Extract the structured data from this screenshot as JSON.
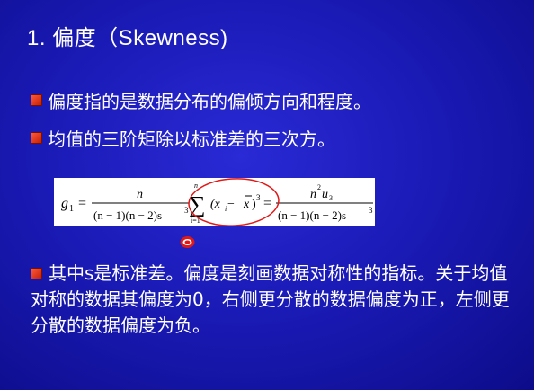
{
  "title": "1. 偏度（Skewness)",
  "bullets": [
    "偏度指的是数据分布的偏倾方向和程度。",
    "均值的三阶矩除以标准差的三次方。"
  ],
  "formula": {
    "lhs": "g",
    "lhs_sub": "1",
    "eq": "=",
    "num1": "n",
    "den1": "(n − 1)(n − 2)s",
    "den1_sup": "3",
    "sum_top": "n",
    "sum_bottom": "i=1",
    "sum_symbol": "∑",
    "term": "(x",
    "term_sub": "i",
    "term_minus": " − ",
    "term_xbar": "x",
    "term_close": ")",
    "term_sup": "3",
    "eq2": "=",
    "num2": "n",
    "num2_sup": "2",
    "num2_u": "u",
    "num2_u_sub": "3",
    "den2": "(n − 1)(n − 2)s",
    "den2_sup": "3"
  },
  "paragraph": "其中s是标准差。偏度是刻画数据对称性的指标。关于均值对称的数据其偏度为0，右侧更分散的数据偏度为正，左侧更分散的数据偏度为负。",
  "colors": {
    "background": "#1b1bb8",
    "bullet": "#d42a10",
    "annotation": "#e01818"
  }
}
